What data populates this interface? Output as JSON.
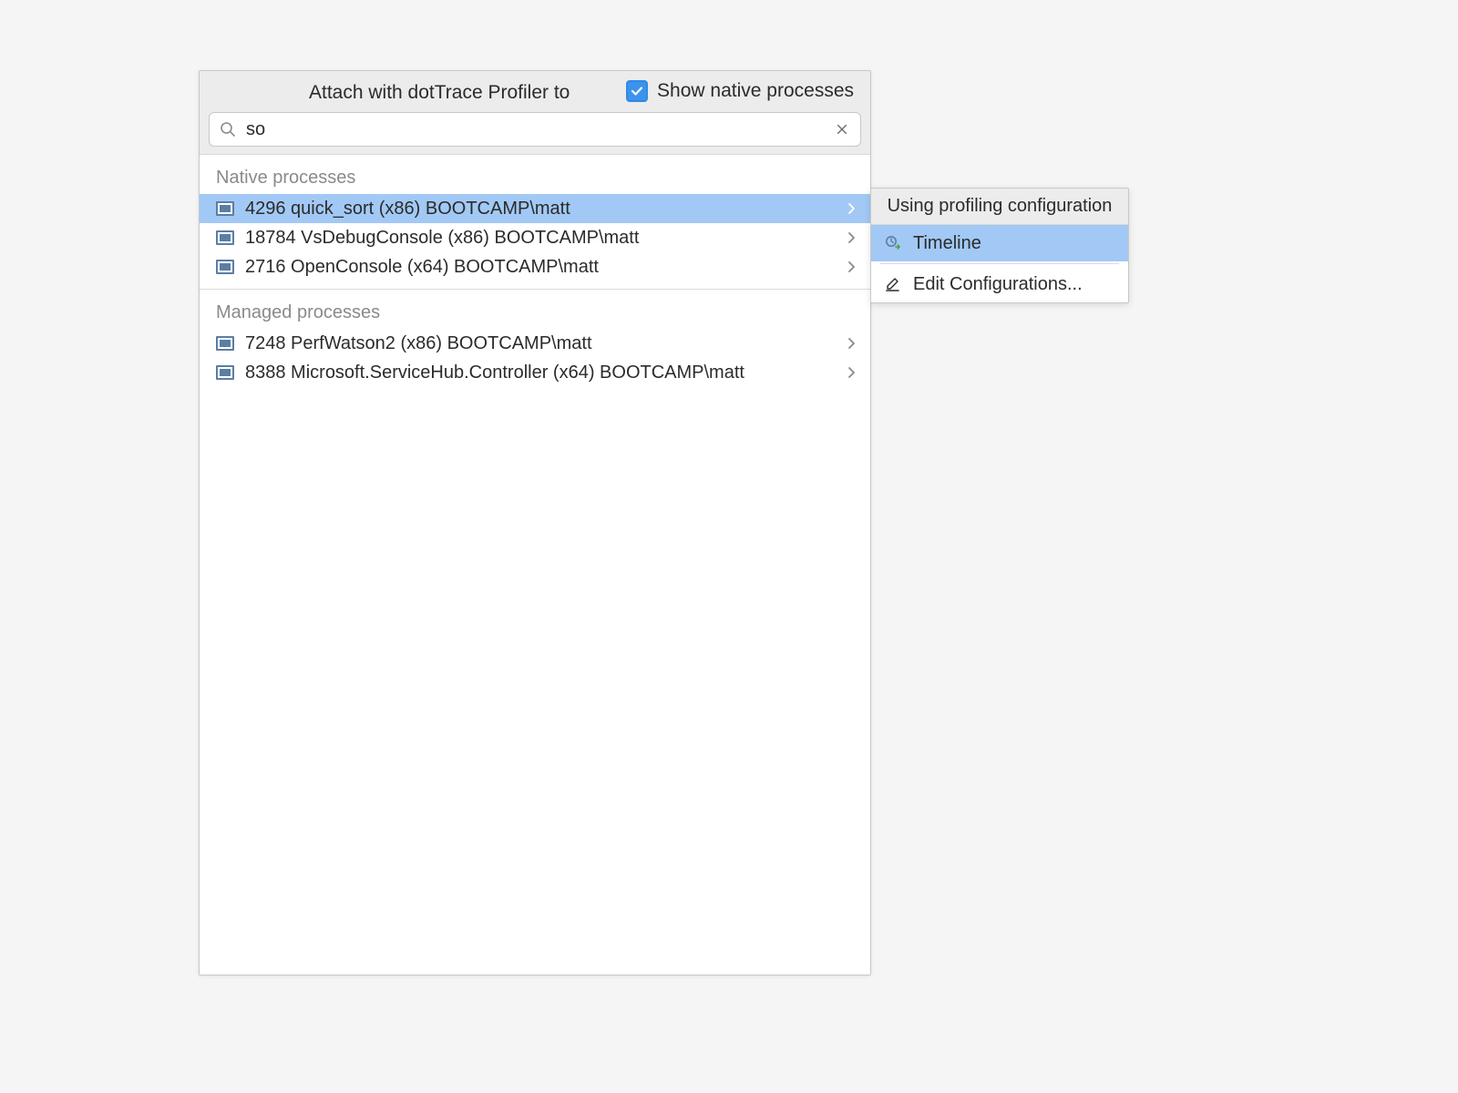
{
  "dialog": {
    "title": "Attach with dotTrace Profiler to",
    "show_native_label": "Show native processes",
    "show_native_checked": true,
    "search_value": "so"
  },
  "sections": {
    "native_title": "Native processes",
    "managed_title": "Managed processes"
  },
  "native_processes": [
    {
      "label": "4296 quick_sort (x86) BOOTCAMP\\matt",
      "selected": true
    },
    {
      "label": "18784 VsDebugConsole (x86) BOOTCAMP\\matt",
      "selected": false
    },
    {
      "label": "2716 OpenConsole (x64) BOOTCAMP\\matt",
      "selected": false
    }
  ],
  "managed_processes": [
    {
      "label": "7248 PerfWatson2 (x86) BOOTCAMP\\matt"
    },
    {
      "label": "8388 Microsoft.ServiceHub.Controller (x64) BOOTCAMP\\matt"
    }
  ],
  "submenu": {
    "header": "Using profiling configuration",
    "timeline_label": "Timeline",
    "edit_label": "Edit Configurations..."
  }
}
